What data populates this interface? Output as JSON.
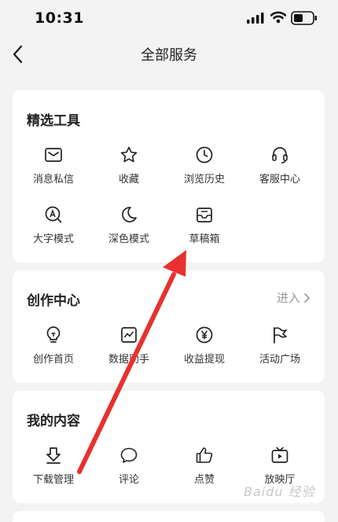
{
  "status_bar": {
    "time": "10:31"
  },
  "header": {
    "title": "全部服务"
  },
  "sections": [
    {
      "title": "精选工具",
      "items": [
        {
          "label": "消息私信",
          "icon": "message-icon"
        },
        {
          "label": "收藏",
          "icon": "star-icon"
        },
        {
          "label": "浏览历史",
          "icon": "clock-icon"
        },
        {
          "label": "客服中心",
          "icon": "headset-icon"
        },
        {
          "label": "大字模式",
          "icon": "font-size-icon"
        },
        {
          "label": "深色模式",
          "icon": "moon-icon"
        },
        {
          "label": "草稿箱",
          "icon": "draft-box-icon"
        }
      ]
    },
    {
      "title": "创作中心",
      "action": "进入",
      "items": [
        {
          "label": "创作首页",
          "icon": "lightbulb-icon"
        },
        {
          "label": "数据助手",
          "icon": "chart-icon"
        },
        {
          "label": "收益提现",
          "icon": "yen-icon"
        },
        {
          "label": "活动广场",
          "icon": "flag-icon"
        }
      ]
    },
    {
      "title": "我的内容",
      "items": [
        {
          "label": "下载管理",
          "icon": "download-icon"
        },
        {
          "label": "评论",
          "icon": "comment-icon"
        },
        {
          "label": "点赞",
          "icon": "thumbs-up-icon"
        },
        {
          "label": "放映厅",
          "icon": "tv-icon"
        }
      ]
    }
  ],
  "watermark": "Baidu 经验",
  "colors": {
    "arrow": "#e8312f",
    "card": "#ffffff",
    "background": "#f3f3f4"
  }
}
